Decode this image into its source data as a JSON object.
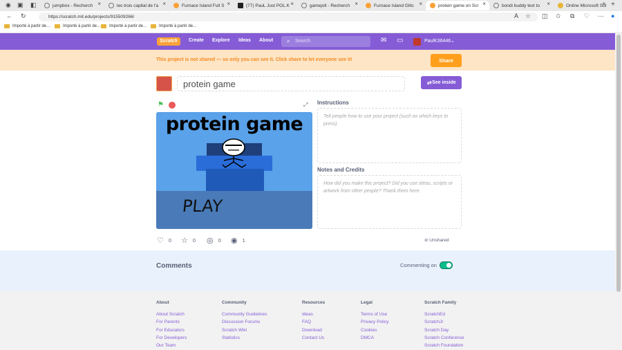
{
  "browser": {
    "tabs": [
      {
        "label": "jumpbox - Recherch"
      },
      {
        "label": "les trois capital de l'a"
      },
      {
        "label": "Furnace Island Full S"
      },
      {
        "label": "(77) PauL Just POL.K"
      },
      {
        "label": "gamejolt - Recherch"
      },
      {
        "label": "Furnace Island Glitc"
      },
      {
        "label": "protein game on Scr"
      },
      {
        "label": "bondi buddy text to"
      },
      {
        "label": "Online Microsoft Sol"
      }
    ],
    "url": "https://scratch.mit.edu/projects/915509266/",
    "bookmarks": [
      {
        "label": "Importé à partir de..."
      },
      {
        "label": "Importé à partir de..."
      },
      {
        "label": "Importé à partir de..."
      },
      {
        "label": "Importé à partir de..."
      }
    ]
  },
  "nav": {
    "logo": "Scratch",
    "links": [
      "Create",
      "Explore",
      "Ideas",
      "About"
    ],
    "search_placeholder": "Search",
    "username": "PaulK36446"
  },
  "banner": {
    "text": "This project is not shared — so only you can see it. Click share to let everyone see it!",
    "share": "Share"
  },
  "project": {
    "title": "protein game",
    "see_inside": "See inside",
    "stage_title": "protein game",
    "stage_play": "PLAY"
  },
  "instructions": {
    "label": "Instructions",
    "placeholder": "Tell people how to use your project (such as which keys to press)."
  },
  "notes": {
    "label": "Notes and Credits",
    "placeholder": "How did you make this project? Did you use ideas, scripts or artwork from other people? Thank them here."
  },
  "stats": {
    "loves": "0",
    "favorites": "0",
    "remixes": "0",
    "views": "1",
    "share_status": "Unshared"
  },
  "comments": {
    "title": "Comments",
    "commenting_label": "Commenting on"
  },
  "footer": {
    "columns": [
      {
        "head": "About",
        "links": [
          "About Scratch",
          "For Parents",
          "For Educators",
          "For Developers",
          "Our Team"
        ]
      },
      {
        "head": "Community",
        "links": [
          "Community Guidelines",
          "Discussion Forums",
          "Scratch Wiki",
          "Statistics"
        ]
      },
      {
        "head": "Resources",
        "links": [
          "Ideas",
          "FAQ",
          "Download",
          "Contact Us"
        ]
      },
      {
        "head": "Legal",
        "links": [
          "Terms of Use",
          "Privacy Policy",
          "Cookies",
          "DMCA"
        ]
      },
      {
        "head": "Scratch Family",
        "links": [
          "ScratchEd",
          "ScratchJr",
          "Scratch Day",
          "Scratch Conference",
          "Scratch Foundation"
        ]
      }
    ]
  },
  "colors": {
    "nav": "#855cd6",
    "banner": "#fde5c5",
    "share": "#ff9f1c",
    "toggle": "#0fbd8c"
  }
}
